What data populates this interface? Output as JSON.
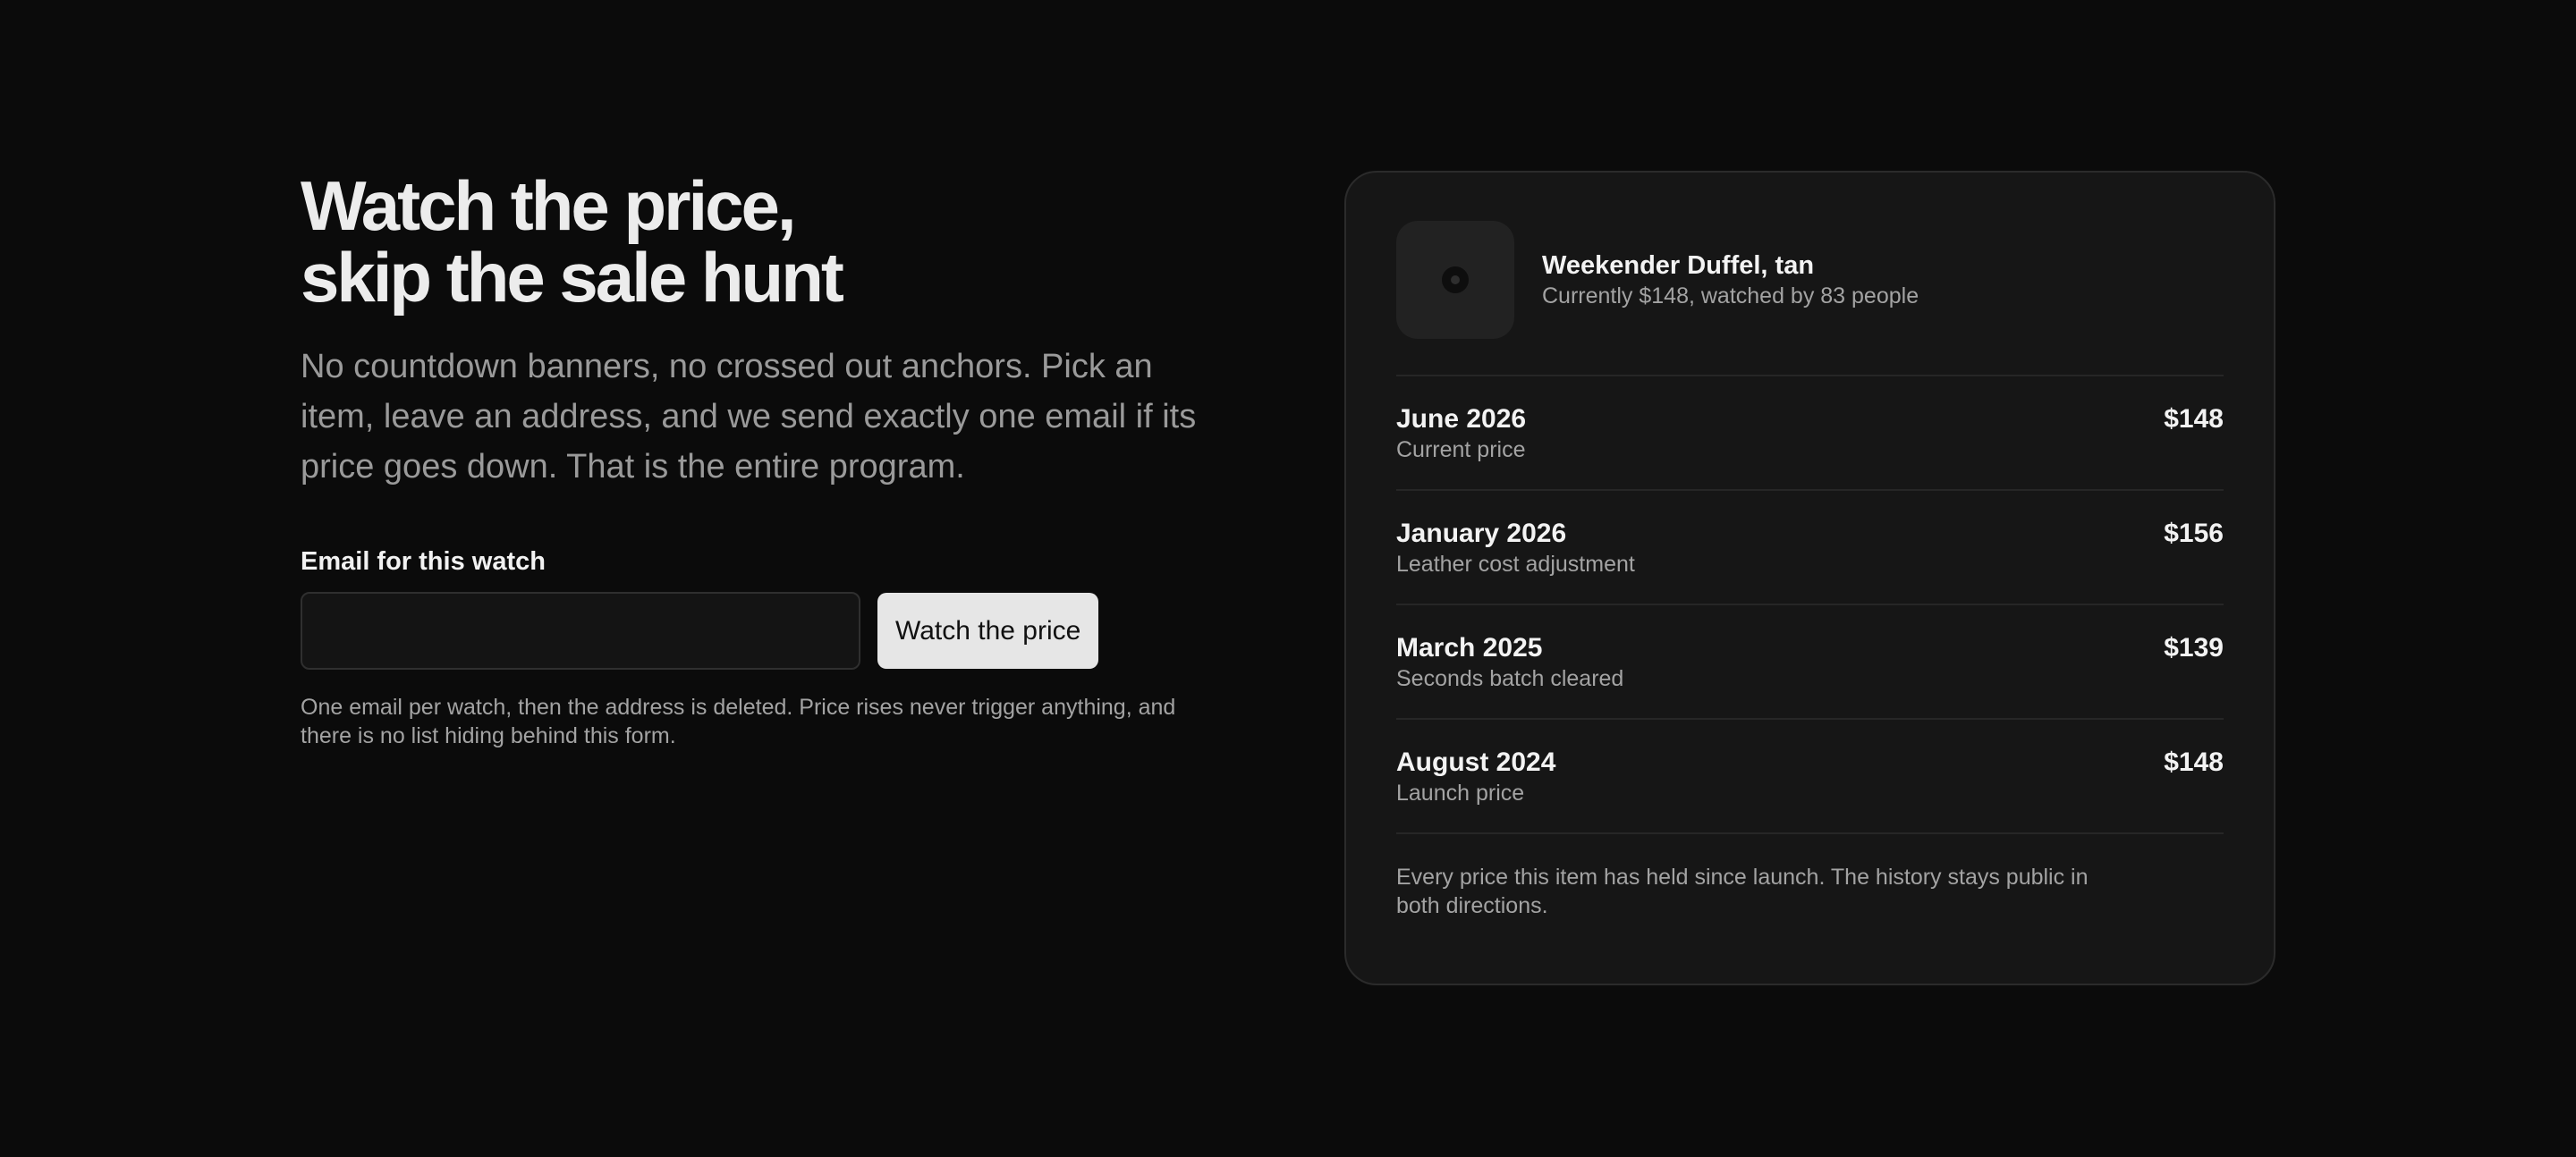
{
  "hero": {
    "headline_line1": "Watch the price,",
    "headline_line2": "skip the sale hunt",
    "lede": "No countdown banners, no crossed out anchors. Pick an item, leave an address, and we send exactly one email if its price goes down. That is the entire program."
  },
  "form": {
    "label": "Email for this watch",
    "email_value": "",
    "email_placeholder": "",
    "button_label": "Watch the price",
    "fineprint": "One email per watch, then the address is deleted. Price rises never trigger anything, and there is no list hiding behind this form."
  },
  "card": {
    "product": {
      "name": "Weekender Duffel, tan",
      "subtitle": "Currently $148, watched by 83 people",
      "thumb_icon": "product-thumbnail-icon"
    },
    "history": [
      {
        "date": "June 2026",
        "note": "Current price",
        "price": "$148"
      },
      {
        "date": "January 2026",
        "note": "Leather cost adjustment",
        "price": "$156"
      },
      {
        "date": "March 2025",
        "note": "Seconds batch cleared",
        "price": "$139"
      },
      {
        "date": "August 2024",
        "note": "Launch price",
        "price": "$148"
      }
    ],
    "footer": "Every price this item has held since launch. The history stays public in both directions."
  },
  "colors": {
    "background": "#0b0b0b",
    "card": "#161616",
    "button": "#e6e6e6",
    "muted_text": "#a3a3a3"
  }
}
